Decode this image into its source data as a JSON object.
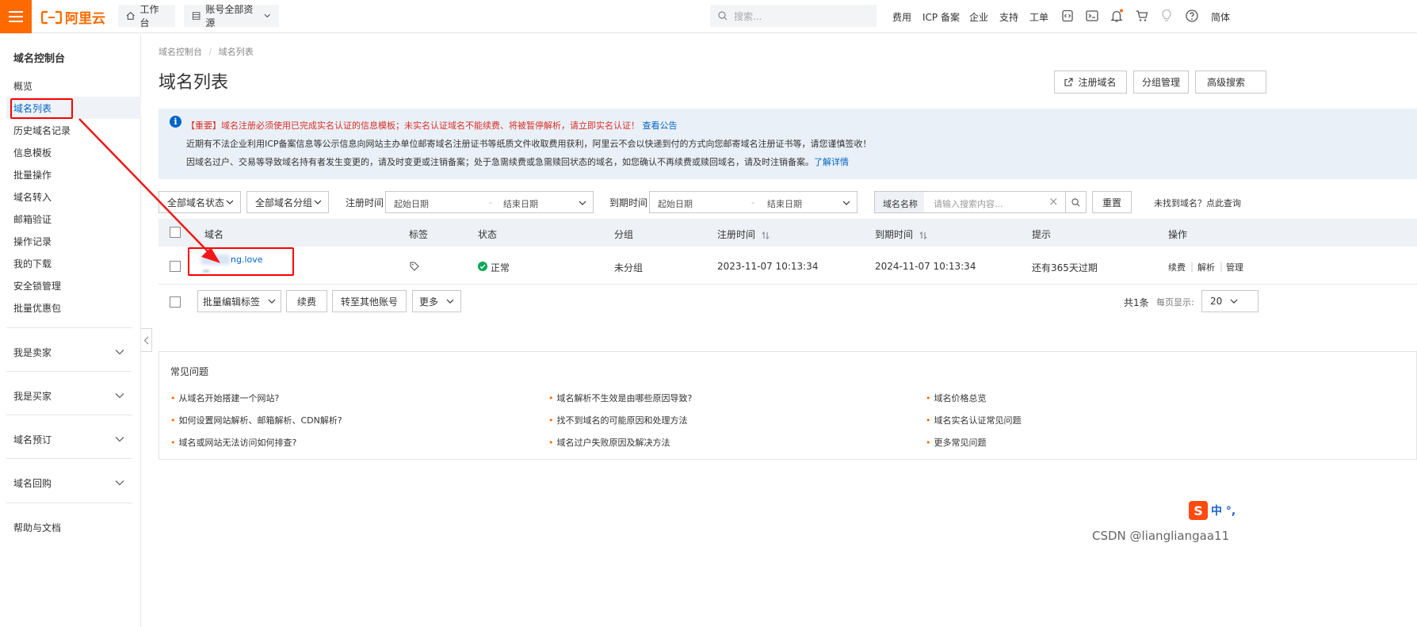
{
  "topbar": {
    "logo_text": "阿里云",
    "workbench": "工作台",
    "resources": "账号全部资源",
    "search_placeholder": "搜索...",
    "nav": [
      "费用",
      "ICP 备案",
      "企业",
      "支持",
      "工单"
    ],
    "lang": "简体"
  },
  "sidebar": {
    "title": "域名控制台",
    "items": [
      "概览",
      "域名列表",
      "历史域名记录",
      "信息模板",
      "批量操作",
      "域名转入",
      "邮箱验证",
      "操作记录",
      "我的下载",
      "安全锁管理",
      "批量优惠包"
    ],
    "active_index": 1,
    "sections": [
      "我是卖家",
      "我是买家",
      "域名预订",
      "域名回购"
    ],
    "help": "帮助与文档"
  },
  "main": {
    "breadcrumb": [
      "域名控制台",
      "域名列表"
    ],
    "breadcrumb_sep": "/",
    "title": "域名列表",
    "actions": [
      "注册域名",
      "分组管理",
      "高级搜索"
    ],
    "notice": {
      "important_tag": "【重要】",
      "line1": "域名注册必须使用已完成实名认证的信息模板；未实名认证域名不能续费、将被暂停解析，请立即实名认证！",
      "line1_link": "查看公告",
      "line2": "近期有不法企业利用ICP备案信息等公示信息向网站主办单位邮寄域名注册证书等纸质文件收取费用获利，阿里云不会以快递到付的方式向您邮寄域名注册证书等，请您谨慎签收！",
      "line3": "因域名过户、交易等导致域名持有者发生变更的，请及时变更或注销备案；处于急需续费或急需赎回状态的域名，如您确认不再续费或赎回域名，请及时注销备案。",
      "line3_link": "了解详情"
    },
    "filters": {
      "status": "全部域名状态",
      "group": "全部域名分组",
      "reg_label": "注册时间",
      "reg_start": "起始日期",
      "reg_sep": "-",
      "reg_end": "结束日期",
      "exp_label": "到期时间",
      "exp_start": "起始日期",
      "exp_sep": "-",
      "exp_end": "结束日期",
      "name_label": "域名名称",
      "name_placeholder": "请输入搜索内容...",
      "clear": "×",
      "reset": "重置",
      "not_found": "未找到域名？点此查询"
    },
    "table": {
      "columns": [
        "域名",
        "标签",
        "状态",
        "分组",
        "注册时间",
        "到期时间",
        "提示",
        "操作"
      ],
      "rows": [
        {
          "domain": "ng.love",
          "status": "正常",
          "group": "未分组",
          "reg_time": "2023-11-07 10:13:34",
          "exp_time": "2024-11-07 10:13:34",
          "tip": "还有365天过期",
          "ops": [
            "续费",
            "解析",
            "管理"
          ]
        }
      ]
    },
    "bulk": {
      "edit_tags": "批量编辑标签",
      "renew": "续费",
      "transfer": "转至其他账号",
      "more": "更多"
    },
    "pager": {
      "total": "共1条",
      "per_page_label": "每页显示:",
      "per_page": "20"
    },
    "faq": {
      "title": "常见问题",
      "items": [
        "从域名开始搭建一个网站?",
        "域名解析不生效是由哪些原因导致?",
        "域名价格总览",
        "如何设置网站解析、邮箱解析、CDN解析?",
        "找不到域名的可能原因和处理方法",
        "域名实名认证常见问题",
        "域名或网站无法访问如何排查?",
        "域名过户失败原因及解决方法",
        "更多常见问题"
      ]
    }
  },
  "overlay": {
    "ime": "中 °,",
    "ime_logo": "S",
    "watermark": "CSDN @liangliangaa11"
  },
  "colors": {
    "brand": "#ff6a00",
    "link": "#0064c8",
    "success": "#00a854",
    "annotation": "#ff0000"
  }
}
